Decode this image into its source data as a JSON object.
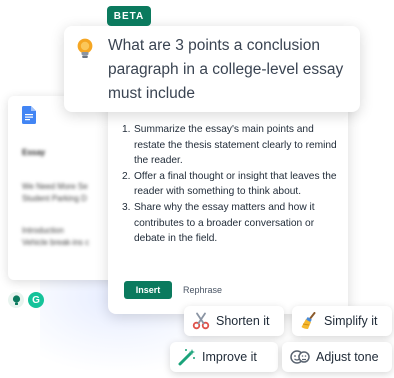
{
  "badge": {
    "label": "BETA"
  },
  "prompt": {
    "text": "What are 3 points a conclusion paragraph in a college-level essay must include",
    "icon": "lightbulb-icon"
  },
  "response": {
    "items": [
      {
        "num": "1.",
        "text": "Summarize the essay's main points and restate the thesis statement clearly to remind the reader."
      },
      {
        "num": "2.",
        "text": "Offer a final thought or insight that leaves the reader with something to think about."
      },
      {
        "num": "3.",
        "text": "Share why the essay matters and how it contributes to a broader conversation or debate in the field."
      }
    ],
    "insert_label": "Insert",
    "rephrase_label": "Rephrase"
  },
  "document": {
    "title": "Essay",
    "lines": [
      "We Need More Se",
      "Student Parking D",
      "Introduction",
      "Vehicle break-ins c"
    ]
  },
  "mini": {
    "g_label": "G"
  },
  "actions": {
    "shorten": "Shorten it",
    "simplify": "Simplify it",
    "improve": "Improve it",
    "adjust": "Adjust tone"
  },
  "colors": {
    "accent": "#0b7a5e",
    "grammarly_green": "#15c39a",
    "doc_blue": "#4285f4"
  }
}
